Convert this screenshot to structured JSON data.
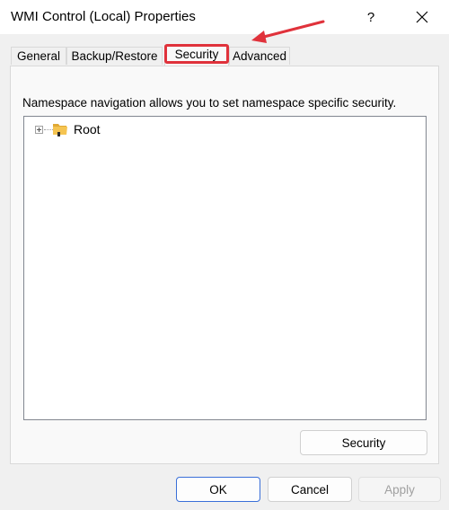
{
  "window": {
    "title": "WMI Control (Local) Properties",
    "help_label": "?",
    "close_icon": "close-icon"
  },
  "tabs": [
    {
      "label": "General"
    },
    {
      "label": "Backup/Restore"
    },
    {
      "label": "Security",
      "selected": true
    },
    {
      "label": "Advanced"
    }
  ],
  "security_tab": {
    "description": "Namespace navigation allows you to set namespace specific security.",
    "tree": [
      {
        "label": "Root",
        "icon": "folder-icon",
        "expandable": true
      }
    ],
    "security_button_label": "Security"
  },
  "footer": {
    "ok_label": "OK",
    "cancel_label": "Cancel",
    "apply_label": "Apply",
    "apply_enabled": false
  },
  "colors": {
    "annotation": "#e0323b",
    "default_button_border": "#3a6fd8"
  }
}
